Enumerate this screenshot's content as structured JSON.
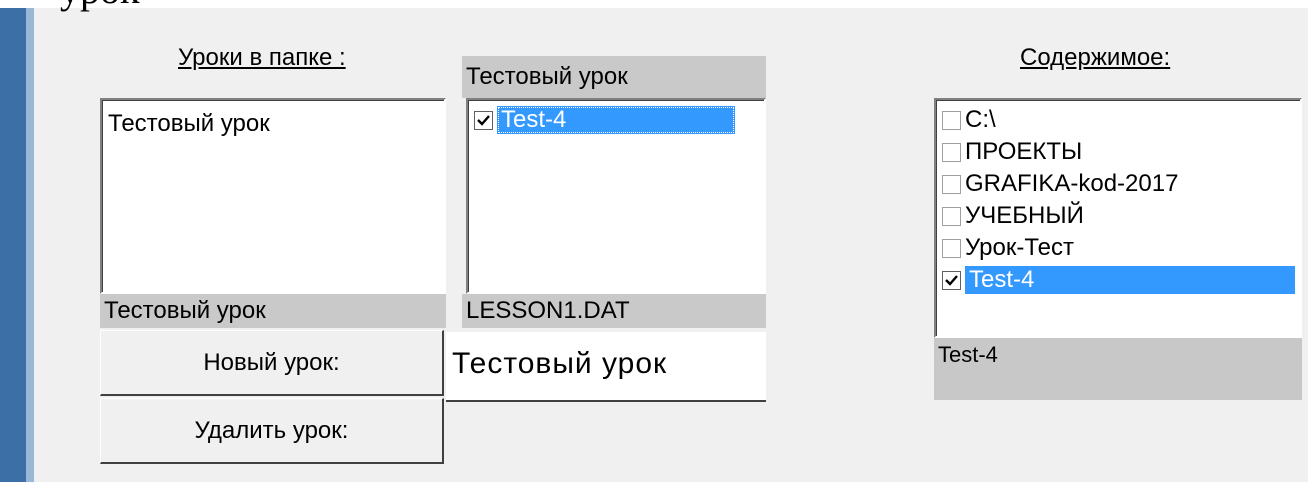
{
  "top_cut_text": "урок",
  "lessons_in_folder": {
    "label": "Уроки в папке :",
    "items": [
      "Тестовый урок"
    ],
    "selected_caption": "Тестовый урок"
  },
  "test_lesson": {
    "caption": "Тестовый урок",
    "items": [
      {
        "label": "Test-4",
        "checked": true,
        "selected": true
      }
    ],
    "file_caption": "LESSON1.DAT"
  },
  "buttons": {
    "new_lesson": "Новый урок:",
    "delete_lesson": "Удалить урок:"
  },
  "lesson_name_field": {
    "value": "Тестовый урок"
  },
  "contents": {
    "label": "Содержимое:",
    "items": [
      {
        "label": "C:\\",
        "checked": false,
        "selected": false
      },
      {
        "label": "ПРОЕКТЫ",
        "checked": false,
        "selected": false
      },
      {
        "label": "GRAFIKA-kod-2017",
        "checked": false,
        "selected": false
      },
      {
        "label": "УЧЕБНЫЙ",
        "checked": false,
        "selected": false
      },
      {
        "label": "Урок-Тест",
        "checked": false,
        "selected": false
      },
      {
        "label": "Test-4",
        "checked": true,
        "selected": true
      }
    ],
    "status": "Test-4"
  },
  "colors": {
    "selection": "#3399ff",
    "left_bar": "#3c6fa6"
  }
}
